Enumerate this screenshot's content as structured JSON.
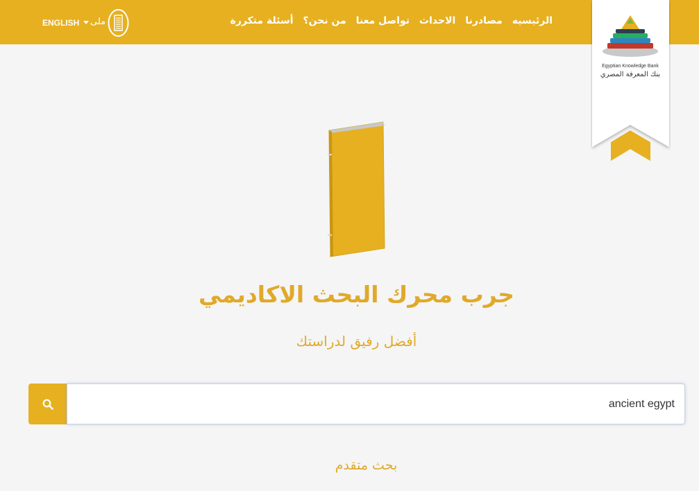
{
  "header": {
    "language_switch": "ENGLISH",
    "account_label": "ملى",
    "nav_items": [
      {
        "label": "الرئيسيه"
      },
      {
        "label": "مصادرنا"
      },
      {
        "label": "الاحداث"
      },
      {
        "label": "تواصل معنا"
      },
      {
        "label": "من نحن؟"
      },
      {
        "label": "أسئلة متكررة"
      }
    ]
  },
  "logo": {
    "name_en": "Egyptian Knowledge Bank",
    "name_ar": "بنك المعرفة المصري"
  },
  "hero": {
    "title": "جرب محرك البحث الاكاديمي",
    "subtitle": "أفضل رفيق لدراستك"
  },
  "search": {
    "value": "ancient egypt",
    "button_icon": "search-icon",
    "advanced_link": "بحث متقدم"
  },
  "colors": {
    "brand": "#e6b020",
    "text_accent": "#e0a92a",
    "background": "#f5f5f5"
  }
}
